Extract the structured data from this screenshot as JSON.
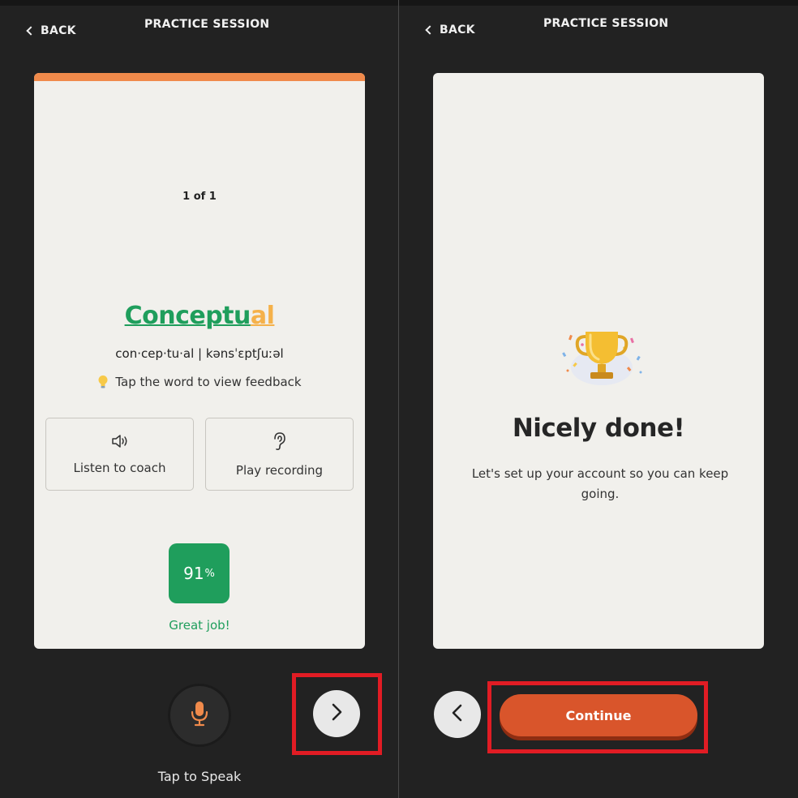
{
  "left_screen": {
    "back_label": "BACK",
    "title": "PRACTICE SESSION",
    "card": {
      "counter": "1 of 1",
      "word_correct_part": "Conceptu",
      "word_flagged_part": "al",
      "phonetics": "con·cep·tu·al | kənsˈɛptʃuːəl",
      "hint": "Tap the word to view feedback",
      "listen_label": "Listen to coach",
      "play_label": "Play recording",
      "score_value": "91",
      "score_unit": "%",
      "score_message": "Great job!"
    },
    "tap_to_speak": "Tap to Speak"
  },
  "right_screen": {
    "back_label": "BACK",
    "title": "PRACTICE SESSION",
    "card": {
      "heading": "Nicely done!",
      "message": "Let's set up your account so you can keep going."
    },
    "continue_label": "Continue"
  },
  "icons": {
    "back": "chevron-left-icon",
    "listen": "speaker-icon",
    "play": "ear-icon",
    "hint": "lightbulb-icon",
    "mic": "microphone-icon",
    "next": "chevron-right-icon",
    "prev": "chevron-left-icon",
    "trophy": "trophy-icon"
  },
  "colors": {
    "background": "#222222",
    "card": "#f1f0ec",
    "accent_bar": "#f08a4b",
    "good": "#1f9e5c",
    "flagged": "#f5b14a",
    "continue_button": "#d9552b",
    "highlight_box": "#e11c24",
    "mic": "#f08a4b"
  }
}
